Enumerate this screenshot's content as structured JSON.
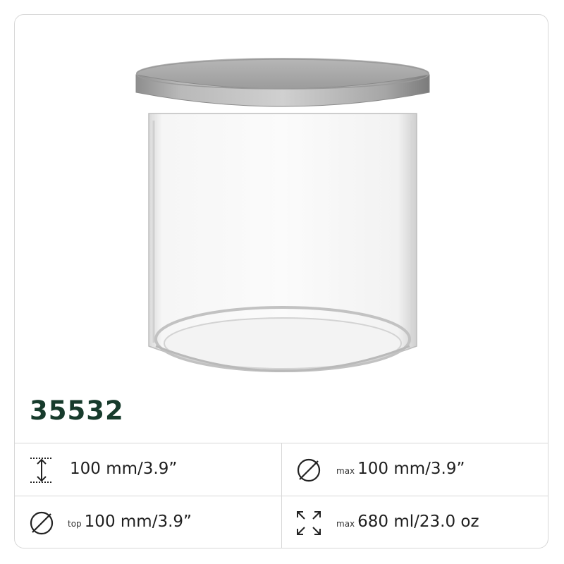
{
  "product": {
    "code": "35532",
    "image_alt": "Clear glass cylindrical jar with silver metal lid"
  },
  "specs": [
    {
      "icon": "height-icon",
      "qualifier": "",
      "value": "100 mm/3.9”"
    },
    {
      "icon": "diameter-icon",
      "qualifier": "max",
      "value": "100 mm/3.9”"
    },
    {
      "icon": "diameter-icon",
      "qualifier": "top",
      "value": "100 mm/3.9”"
    },
    {
      "icon": "volume-icon",
      "qualifier": "max",
      "value": "680 ml/23.0 oz"
    }
  ],
  "colors": {
    "code": "#173b2c",
    "border": "#d7d7d7",
    "lid": "#a9a9a9"
  }
}
